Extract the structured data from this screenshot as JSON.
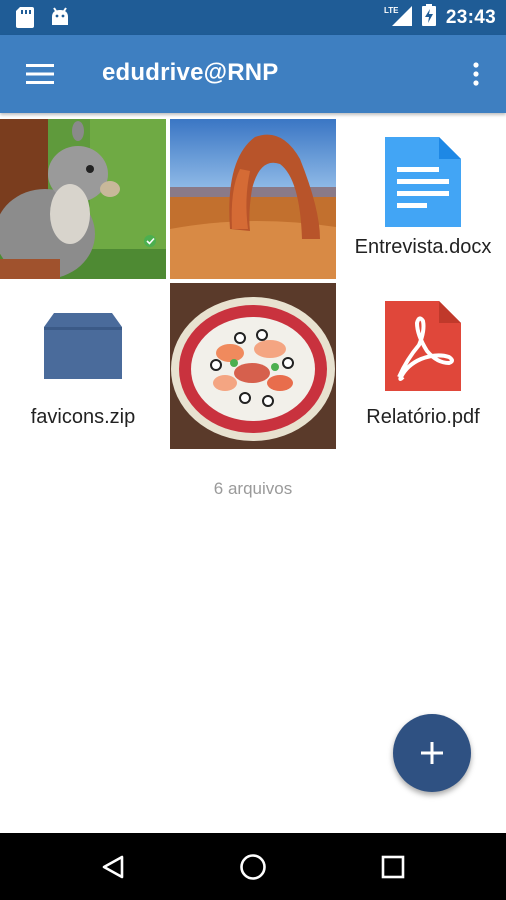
{
  "status_bar": {
    "time": "23:43",
    "network": "LTE",
    "left_icons": [
      "sd-card-icon",
      "android-icon"
    ],
    "right_icons": [
      "signal-icon",
      "battery-charging-icon"
    ]
  },
  "app_bar": {
    "title": "edudrive@RNP",
    "menu_icon": "hamburger-icon",
    "overflow_icon": "more-vert-icon",
    "color": "#3e7fc1"
  },
  "files": [
    {
      "type": "image",
      "subject": "squirrel",
      "synced": true
    },
    {
      "type": "image",
      "subject": "desert-arch"
    },
    {
      "type": "document",
      "name": "Entrevista.docx",
      "icon": "docx-icon",
      "color": "#42a5f5"
    },
    {
      "type": "archive",
      "name": "favicons.zip",
      "icon": "folder-box-icon",
      "color": "#4a6b9b"
    },
    {
      "type": "image",
      "subject": "sushi-platter"
    },
    {
      "type": "document",
      "name": "Relatório.pdf",
      "icon": "pdf-icon",
      "color": "#e0473a"
    }
  ],
  "file_count_label": "6 arquivos",
  "fab": {
    "icon": "plus-icon",
    "color": "#2f5182"
  },
  "nav_bar": {
    "buttons": [
      "back-icon",
      "home-icon",
      "recents-icon"
    ]
  }
}
